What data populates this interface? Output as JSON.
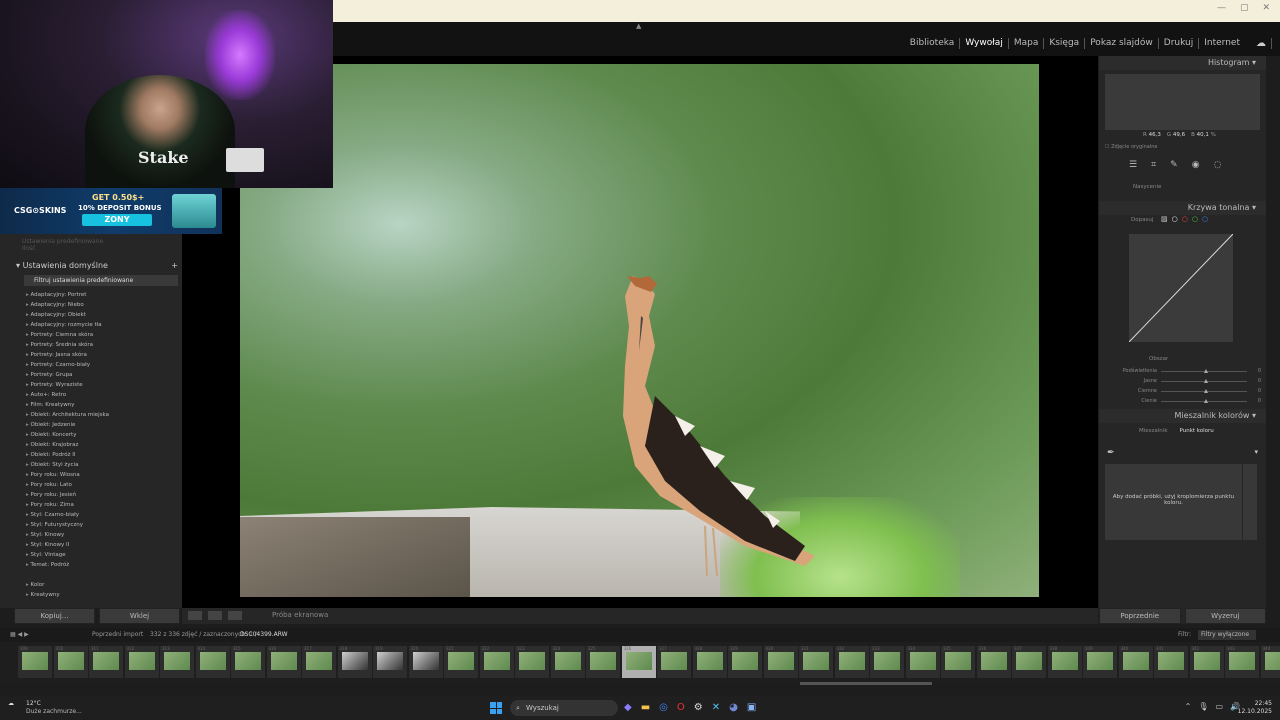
{
  "modules": [
    "Biblioteka",
    "Wywołaj",
    "Mapa",
    "Księga",
    "Pokaz slajdów",
    "Drukuj",
    "Internet"
  ],
  "active_module": "Wywołaj",
  "left_panel": {
    "dim_rows": [
      "Ustawienia predefiniowane",
      "Ilość"
    ],
    "section_title": "Ustawienia domyślne",
    "filter_label": "Filtruj ustawienia predefiniowane",
    "presets": [
      "Adaptacyjny: Portret",
      "Adaptacyjny: Niebo",
      "Adaptacyjny: Obiekt",
      "Adaptacyjny: rozmycie tła",
      "Portrety: Ciemna skóra",
      "Portrety: Średnia skóra",
      "Portrety: Jasna skóra",
      "Portrety: Czarno-biały",
      "Portrety: Grupa",
      "Portrety: Wyraziste",
      "Auto+: Retro",
      "Film: Kreatywny",
      "Obiekt: Architektura miejska",
      "Obiekt: Jedzenie",
      "Obiekt: Koncerty",
      "Obiekt: Krajobraz",
      "Obiekt: Podróż II",
      "Obiekt: Styl życia",
      "Pory roku: Wiosna",
      "Pory roku: Lato",
      "Pory roku: Jesień",
      "Pory roku: Zima",
      "Styl: Czarno-biały",
      "Styl: Futurystyczny",
      "Styl: Kinowy",
      "Styl: Kinowy II",
      "Styl: Vintage",
      "Temat: Podróż"
    ],
    "sub_presets": [
      "Kolor",
      "Kreatywny"
    ],
    "copy_button": "Kopiuj...",
    "paste_button": "Wklej"
  },
  "banner": {
    "logo": "CSG⊙SKINS",
    "line1": "GET 0.50$+",
    "line2": "10% DEPOSIT BONUS",
    "line3": "ZONY"
  },
  "webcam": {
    "shirt_text": "Stake"
  },
  "right_panel": {
    "histogram_title": "Histogram",
    "rgb": {
      "r_label": "R",
      "r": "46,3",
      "g_label": "G",
      "g": "49,6",
      "b_label": "B",
      "b": "40,1",
      "unit": "%"
    },
    "original_label": "Zdjęcie oryginalne",
    "saturation_label": "Nasycenie",
    "tone_curve_title": "Krzywa tonalna",
    "tone_curve_sub": "Dopasuj",
    "region_label": "Obszar",
    "sliders": [
      {
        "label": "Podświetlenia",
        "value": "0"
      },
      {
        "label": "Jasne",
        "value": "0"
      },
      {
        "label": "Ciemne",
        "value": "0"
      },
      {
        "label": "Cienie",
        "value": "0"
      }
    ],
    "mixer_title": "Mieszalnik kolorów",
    "mixer_tabs": [
      "Mieszalnik",
      "Punkt koloru"
    ],
    "mixer_active_tab": "Punkt koloru",
    "mixer_hint": "Aby dodać próbki, użyj kroplomierza punktu koloru.",
    "prev_button": "Poprzednie",
    "reset_button": "Wyzeruj"
  },
  "toolbar": {
    "soft_proof": "Próba ekranowa"
  },
  "filmstrip": {
    "source": "Poprzedni import",
    "count": "332 z 336 zdjęć / zaznaczonych: 1 /",
    "filename": "DSC04399.ARW",
    "filter_label": "Filtr:",
    "filter_value": "Filtry wyłączone",
    "frame_numbers": [
      "309",
      "310",
      "311",
      "312",
      "313",
      "314",
      "315",
      "316",
      "317",
      "318",
      "319",
      "320",
      "321",
      "322",
      "323",
      "324",
      "325",
      "326",
      "327",
      "328",
      "329",
      "330",
      "331",
      "332",
      "333",
      "334",
      "335",
      "336",
      "337",
      "338",
      "339",
      "340",
      "341",
      "342",
      "343",
      "344"
    ],
    "selected_index": 17
  },
  "taskbar": {
    "temp": "12°C",
    "weather": "Duże zachmurze...",
    "search": "Wyszukaj",
    "time": "22:45",
    "date": "12.10.2025"
  },
  "colors": {
    "accent_windows": "#3aa0f0",
    "panel": "#262626",
    "background": "#1d1d1d"
  }
}
